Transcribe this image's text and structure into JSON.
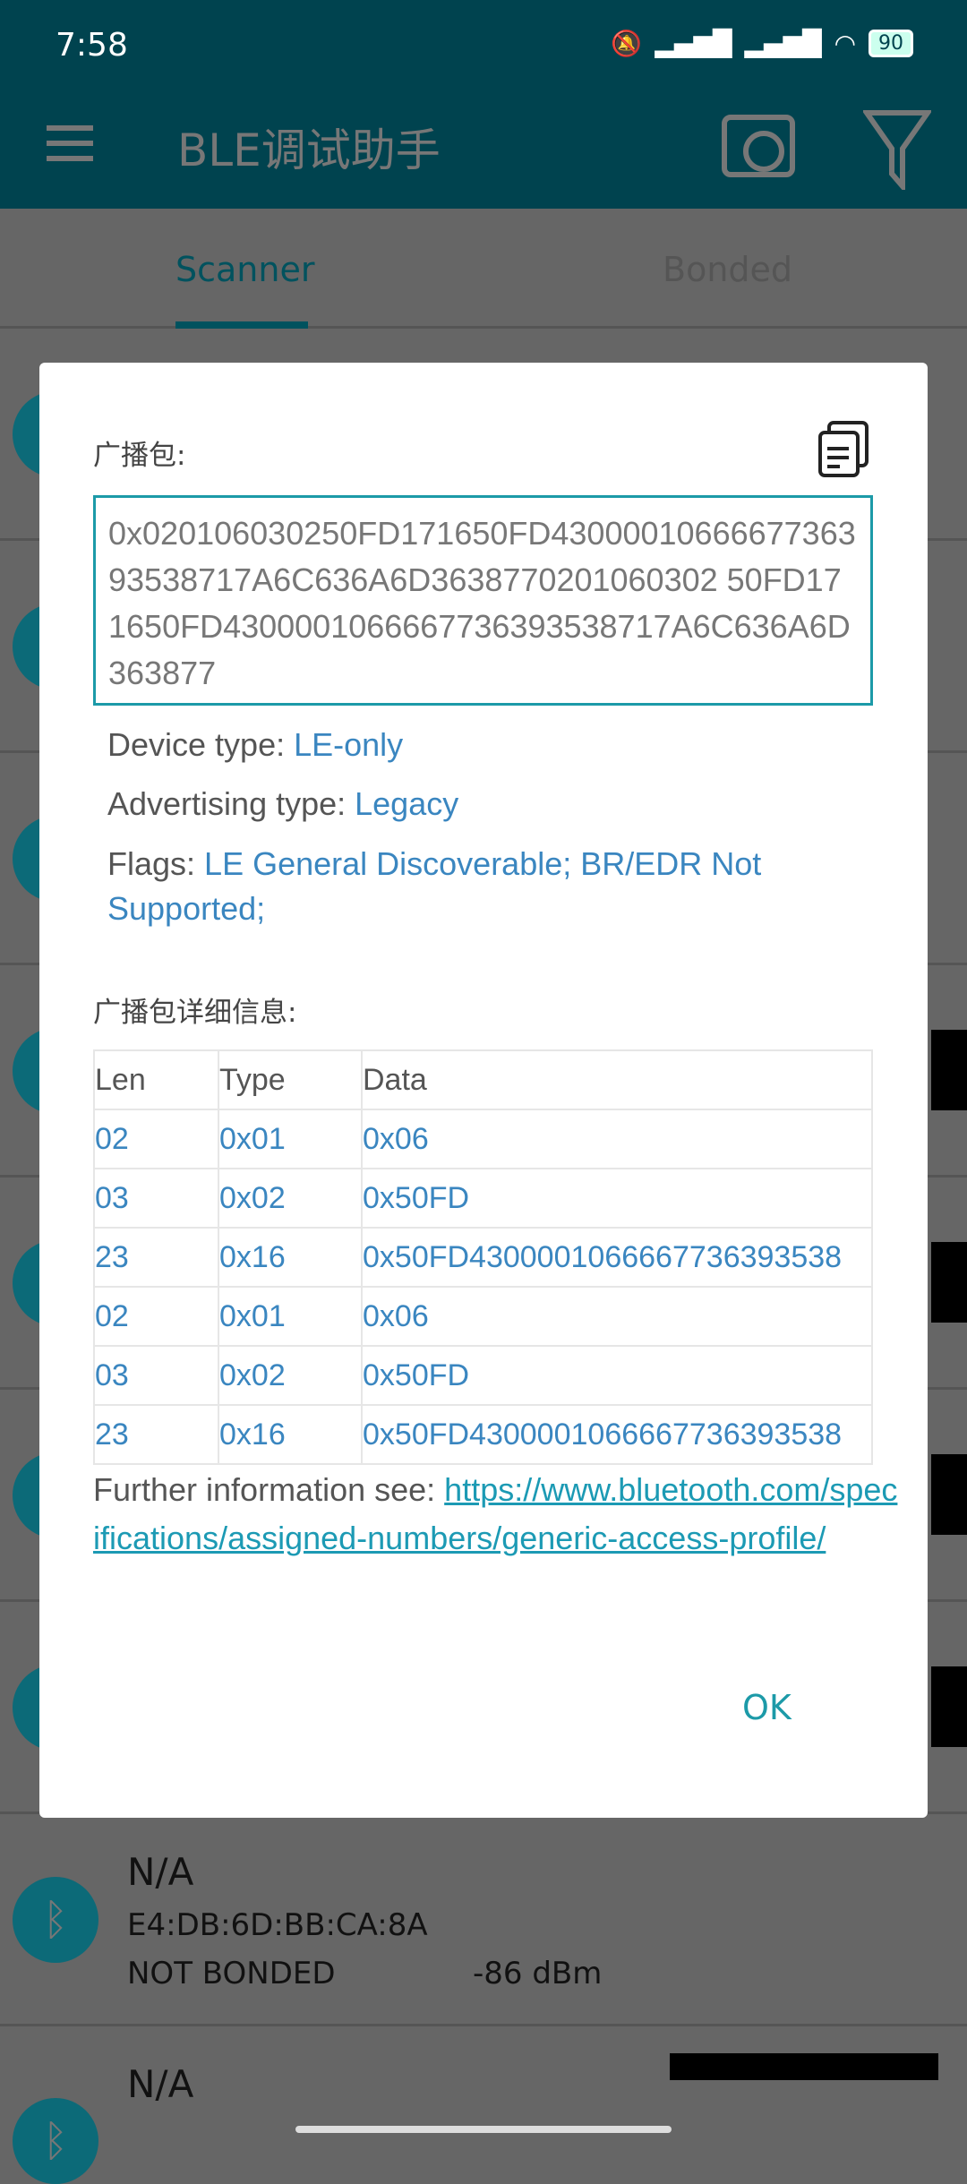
{
  "status": {
    "time": "7:58",
    "battery": "90",
    "icons": [
      "mute-icon",
      "signal-hd-icon",
      "signal-hd-icon",
      "wifi-icon",
      "battery-icon"
    ]
  },
  "appbar": {
    "title": "BLE调试助手",
    "icons": [
      "menu-icon",
      "camera-icon",
      "filter-icon"
    ]
  },
  "tabs": [
    {
      "label": "Scanner",
      "active": true
    },
    {
      "label": "Bonded",
      "active": false
    }
  ],
  "background_list": [
    {
      "name": "N/A",
      "mac": "E4:DB:6D:BB:CA:8A",
      "bond": "NOT BONDED",
      "rssi": "-86 dBm"
    },
    {
      "name": "N/A"
    }
  ],
  "dialog": {
    "adv_label": "广播包:",
    "adv_hex": "0x020106030250FD171650FD4300001066667736393538717A6C636A6D3638770201060302 50FD171650FD4300001066667736393538717A6C636A6D363877",
    "device_type_label": "Device type: ",
    "device_type": "LE-only",
    "adv_type_label": "Advertising type: ",
    "adv_type": "Legacy",
    "flags_label": "Flags: ",
    "flags": "LE General Discoverable; BR/EDR Not Supported;",
    "detail_label": "广播包详细信息:",
    "table": {
      "headers": [
        "Len",
        "Type",
        "Data"
      ],
      "rows": [
        [
          "02",
          "0x01",
          "0x06"
        ],
        [
          "03",
          "0x02",
          "0x50FD"
        ],
        [
          "23",
          "0x16",
          "0x50FD4300001066667736393538"
        ],
        [
          "02",
          "0x01",
          "0x06"
        ],
        [
          "03",
          "0x02",
          "0x50FD"
        ],
        [
          "23",
          "0x16",
          "0x50FD4300001066667736393538"
        ]
      ]
    },
    "further_label": "Further information see: ",
    "further_link": "https://www.bluetooth.com/specifications/assigned-numbers/generic-access-profile/",
    "ok": "OK"
  },
  "colors": {
    "accent": "#1c9aa8",
    "value": "#3a86c0",
    "appbar": "#00434f"
  }
}
